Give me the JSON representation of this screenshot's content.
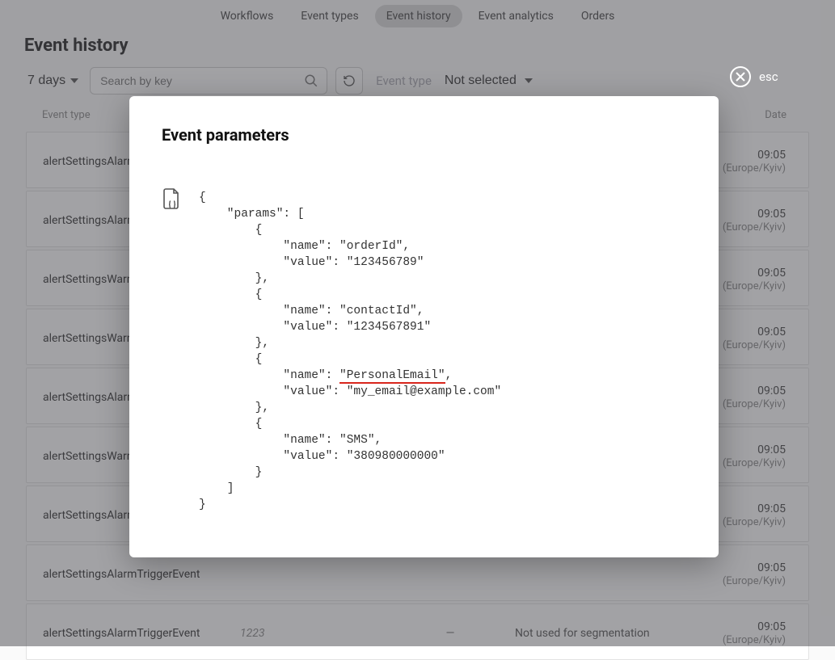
{
  "nav": {
    "workflows": "Workflows",
    "event_types": "Event types",
    "event_history": "Event history",
    "event_analytics": "Event analytics",
    "orders": "Orders"
  },
  "page_title": "Event history",
  "toolbar": {
    "range_label": "7 days",
    "search_placeholder": "Search by key",
    "event_type_label": "Event type",
    "not_selected_label": "Not selected"
  },
  "table": {
    "headers": {
      "event_type": "Event type",
      "date": "Date"
    },
    "rows": [
      {
        "type": "alertSettingsAlarmTriggerEvent",
        "id": "",
        "dash": "",
        "seg": "",
        "time": "09:05",
        "tz": "(Europe/Kyiv)"
      },
      {
        "type": "alertSettingsAlarmTriggerEvent",
        "id": "",
        "dash": "",
        "seg": "",
        "time": "09:05",
        "tz": "(Europe/Kyiv)"
      },
      {
        "type": "alertSettingsWarningTriggerEvent",
        "id": "",
        "dash": "",
        "seg": "",
        "time": "09:05",
        "tz": "(Europe/Kyiv)"
      },
      {
        "type": "alertSettingsWarningTriggerEvent",
        "id": "",
        "dash": "",
        "seg": "",
        "time": "09:05",
        "tz": "(Europe/Kyiv)"
      },
      {
        "type": "alertSettingsAlarmTriggerEvent",
        "id": "",
        "dash": "",
        "seg": "",
        "time": "09:05",
        "tz": "(Europe/Kyiv)"
      },
      {
        "type": "alertSettingsWarningTriggerEvent",
        "id": "",
        "dash": "",
        "seg": "",
        "time": "09:05",
        "tz": "(Europe/Kyiv)"
      },
      {
        "type": "alertSettingsAlarmTriggerEvent",
        "id": "",
        "dash": "",
        "seg": "",
        "time": "09:05",
        "tz": "(Europe/Kyiv)"
      },
      {
        "type": "alertSettingsAlarmTriggerEvent",
        "id": "",
        "dash": "",
        "seg": "",
        "time": "09:05",
        "tz": "(Europe/Kyiv)"
      },
      {
        "type": "alertSettingsAlarmTriggerEvent",
        "id": "1223",
        "dash": "—",
        "seg": "Not used for segmentation",
        "time": "09:05",
        "tz": "(Europe/Kyiv)"
      }
    ]
  },
  "modal": {
    "title": "Event parameters",
    "json": {
      "l1": "{",
      "l2": "    \"params\": [",
      "l3": "        {",
      "l4": "            \"name\": \"orderId\",",
      "l5": "            \"value\": \"123456789\"",
      "l6": "        },",
      "l7": "        {",
      "l8": "            \"name\": \"contactId\",",
      "l9": "            \"value\": \"1234567891\"",
      "l10": "        },",
      "l11": "        {",
      "l12a": "            \"name\": ",
      "l12b": "\"PersonalEmail\"",
      "l12c": ",",
      "l13": "            \"value\": \"my_email@example.com\"",
      "l14": "        },",
      "l15": "        {",
      "l16": "            \"name\": \"SMS\",",
      "l17": "            \"value\": \"380980000000\"",
      "l18": "        }",
      "l19": "    ]",
      "l20": "}"
    },
    "esc_label": "esc"
  }
}
